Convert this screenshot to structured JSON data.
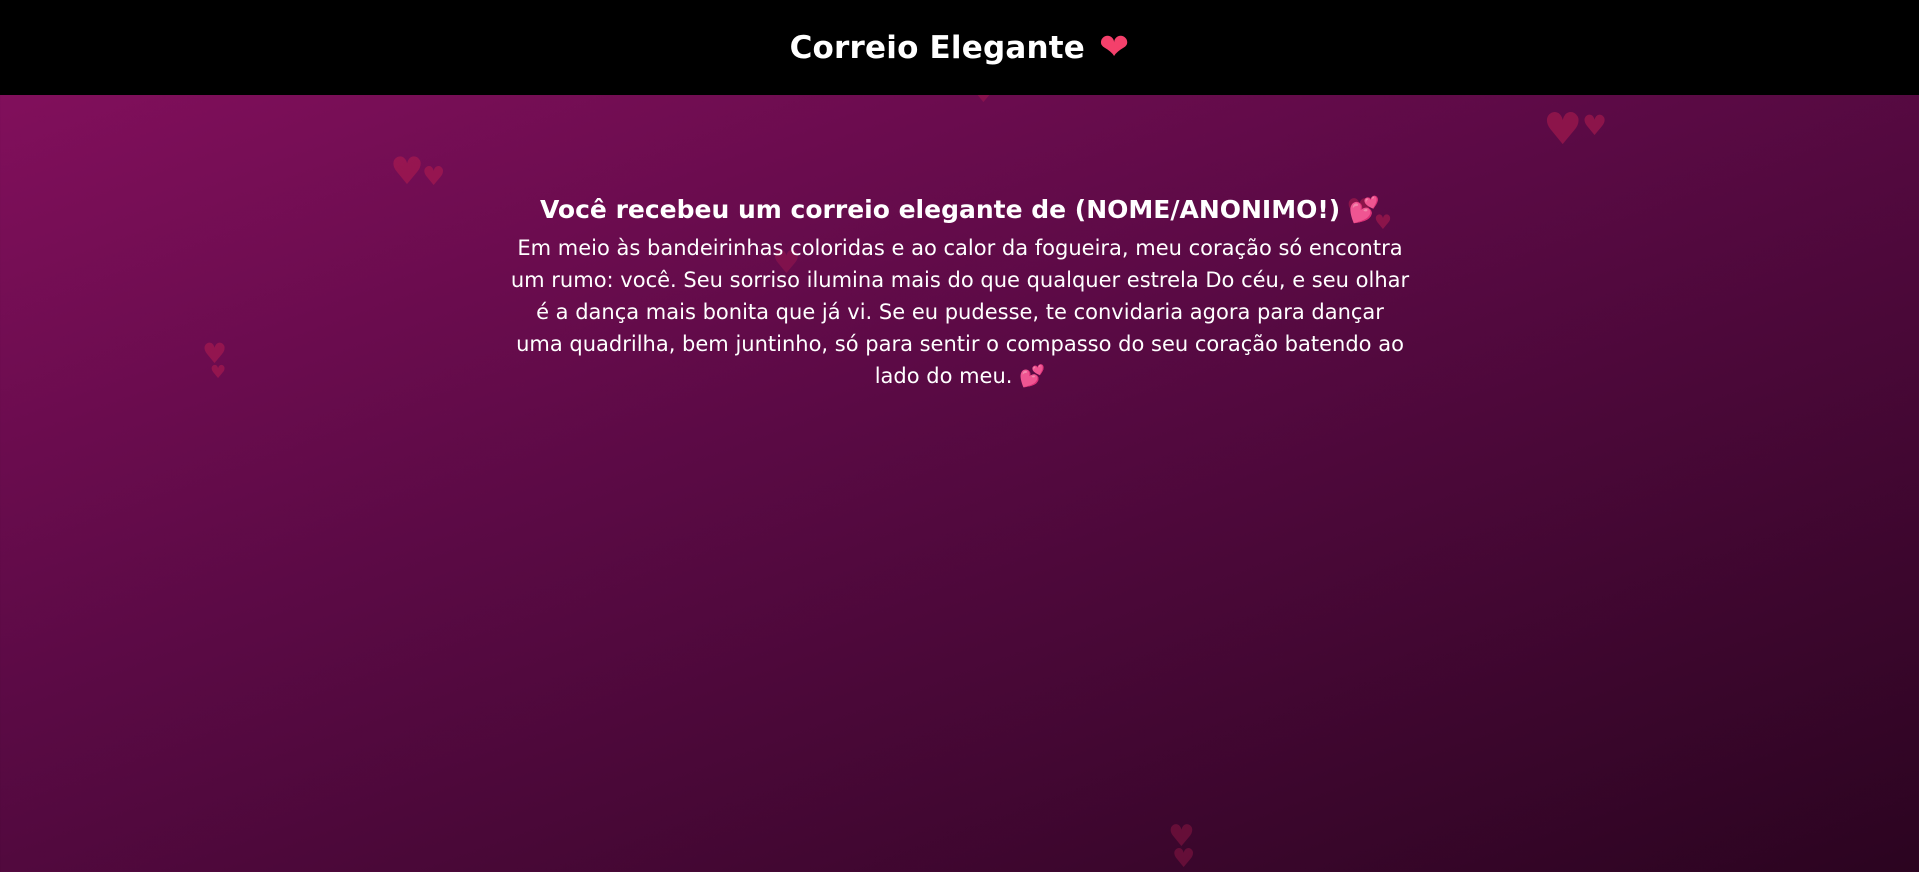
{
  "header": {
    "title": "Correio Elegante",
    "heart_icon": "heart-icon"
  },
  "message": {
    "title": "Você recebeu um correio elegante de (NOME/ANONIMO!)",
    "title_emoji": "💕",
    "body": "Em meio às bandeirinhas coloridas e ao calor da fogueira, meu coração só encontra um rumo: você. Seu sorriso ilumina mais do que qualquer estrela Do céu, e seu olhar é a dança mais bonita que já vi. Se eu pudesse, te convidaria agora para dançar uma quadrilha, bem juntinho, só para sentir o compasso do seu coração batendo ao lado do meu.",
    "body_emoji": "💕"
  },
  "colors": {
    "background_start": "#87105f",
    "background_end": "#2b0420",
    "header_bg": "#000000",
    "heart": "#f4406b",
    "floating_heart": "#b41d4f"
  }
}
